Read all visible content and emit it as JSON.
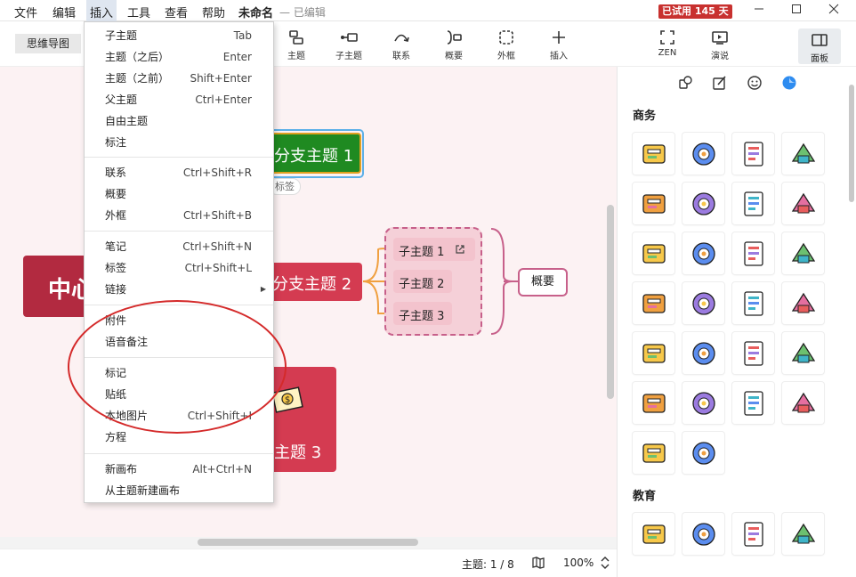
{
  "menubar": {
    "items": [
      {
        "label": "文件"
      },
      {
        "label": "编辑"
      },
      {
        "label": "插入"
      },
      {
        "label": "工具"
      },
      {
        "label": "查看"
      },
      {
        "label": "帮助"
      }
    ],
    "doc_title": "未命名",
    "doc_status": "— 已编辑",
    "trial_badge": "已试用 145 天"
  },
  "toolbar": {
    "view_mode": "思维导图",
    "buttons": [
      {
        "label": "主题",
        "icon": "topic-icon"
      },
      {
        "label": "子主题",
        "icon": "subtopic-icon"
      },
      {
        "label": "联系",
        "icon": "relationship-icon"
      },
      {
        "label": "概要",
        "icon": "summary-icon"
      },
      {
        "label": "外框",
        "icon": "boundary-icon"
      },
      {
        "label": "插入",
        "icon": "plus-icon"
      }
    ],
    "zen_label": "ZEN",
    "present_label": "演说",
    "panel_label": "面板"
  },
  "insert_menu": {
    "groups": [
      [
        {
          "label": "子主题",
          "shortcut": "Tab"
        },
        {
          "label": "主题（之后）",
          "shortcut": "Enter"
        },
        {
          "label": "主题（之前）",
          "shortcut": "Shift+Enter"
        },
        {
          "label": "父主题",
          "shortcut": "Ctrl+Enter"
        },
        {
          "label": "自由主题",
          "shortcut": ""
        },
        {
          "label": "标注",
          "shortcut": ""
        }
      ],
      [
        {
          "label": "联系",
          "shortcut": "Ctrl+Shift+R"
        },
        {
          "label": "概要",
          "shortcut": ""
        },
        {
          "label": "外框",
          "shortcut": "Ctrl+Shift+B"
        }
      ],
      [
        {
          "label": "笔记",
          "shortcut": "Ctrl+Shift+N"
        },
        {
          "label": "标签",
          "shortcut": "Ctrl+Shift+L"
        },
        {
          "label": "链接",
          "shortcut": "",
          "submenu": true
        }
      ],
      [
        {
          "label": "附件",
          "shortcut": ""
        },
        {
          "label": "语音备注",
          "shortcut": ""
        }
      ],
      [
        {
          "label": "标记",
          "shortcut": ""
        },
        {
          "label": "贴纸",
          "shortcut": ""
        },
        {
          "label": "本地图片",
          "shortcut": "Ctrl+Shift+I"
        },
        {
          "label": "方程",
          "shortcut": ""
        }
      ],
      [
        {
          "label": "新画布",
          "shortcut": "Alt+Ctrl+N"
        },
        {
          "label": "从主题新建画布",
          "shortcut": ""
        }
      ]
    ]
  },
  "canvas": {
    "central_partial": "中心",
    "branch1": "分支主题 1",
    "branch1_tag": "标签",
    "branch2": "分支主题 2",
    "branch3": "主题 3",
    "subtopics": [
      "子主题 1",
      "子主题 2",
      "子主题 3"
    ],
    "summary": "概要",
    "colors": {
      "central": "#b22a40",
      "branch1": "#1f8a21",
      "branch2": "#d43b51",
      "branch3": "#d43b51",
      "summary_border": "#c7608a",
      "connector": "#f0a040"
    }
  },
  "status": {
    "topic_count": "主题: 1 / 8",
    "zoom": "100%"
  },
  "sidebar": {
    "tabs": [
      "style-icon",
      "format-icon",
      "emoji-icon",
      "sticker-icon"
    ],
    "section_business": "商务",
    "section_education": "教育",
    "stickers_business": [
      "money-icon",
      "briefcase-icon",
      "calculator-icon",
      "chat-icon",
      "coffee-icon",
      "contacts-icon",
      "support-icon",
      "mail-icon",
      "document-search-icon",
      "folder-icon",
      "globe-icon",
      "mailbox-icon",
      "turntable-icon",
      "newspaper-icon",
      "book-icon",
      "presentation-icon",
      "printer-icon",
      "analytics-icon",
      "target-icon",
      "team-icon",
      "clock-icon",
      "checklist-icon",
      "bar-chart-icon",
      "coins-icon",
      "microphone-icon",
      "id-card-icon"
    ],
    "stickers_education": [
      "atom-icon",
      "scales-icon",
      "flask-icon",
      "newton-cradle-icon"
    ]
  }
}
